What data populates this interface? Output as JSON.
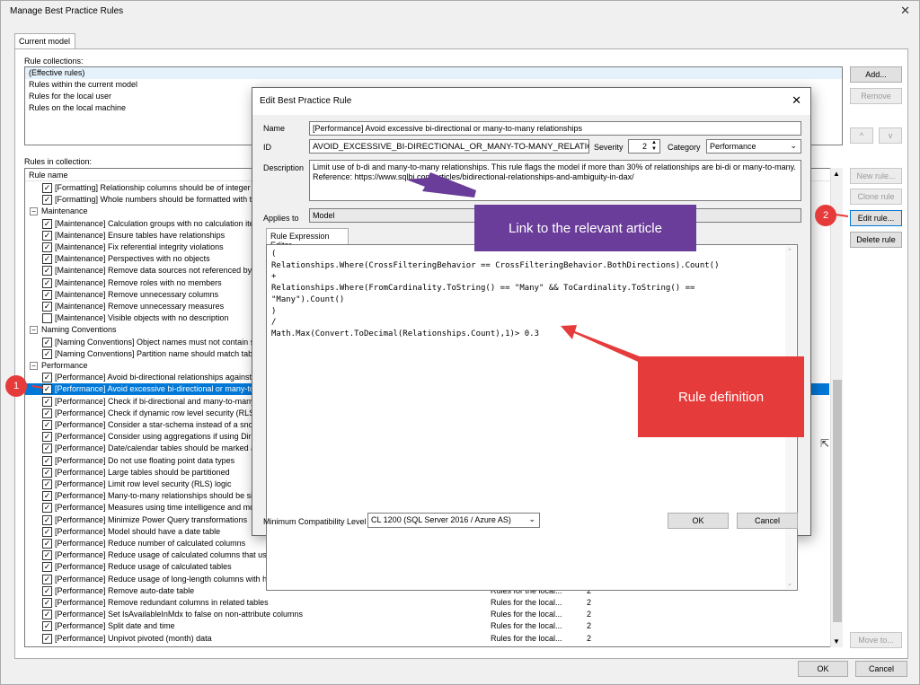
{
  "window": {
    "title": "Manage Best Practice Rules"
  },
  "tabs": [
    {
      "label": "Current model"
    }
  ],
  "collections": {
    "label": "Rule collections:",
    "items": [
      "(Effective rules)",
      "Rules within the current model",
      "Rules for the local user",
      "Rules on the local machine"
    ]
  },
  "collection_buttons": {
    "add": "Add...",
    "remove": "Remove",
    "up": "^",
    "down": "v"
  },
  "rules": {
    "label": "Rules in collection:",
    "header": "Rule name",
    "rows": [
      {
        "kind": "rule",
        "checked": true,
        "name": "[Formatting] Relationship columns should be of integer data type",
        "col2": "",
        "col3": ""
      },
      {
        "kind": "rule",
        "checked": true,
        "name": "[Formatting] Whole numbers should be formatted with thousands separators",
        "col2": "",
        "col3": ""
      },
      {
        "kind": "group",
        "name": "Maintenance"
      },
      {
        "kind": "rule",
        "checked": true,
        "name": "[Maintenance] Calculation groups with no calculation items",
        "col2": "",
        "col3": ""
      },
      {
        "kind": "rule",
        "checked": true,
        "name": "[Maintenance] Ensure tables have relationships",
        "col2": "",
        "col3": ""
      },
      {
        "kind": "rule",
        "checked": true,
        "name": "[Maintenance] Fix referential integrity violations",
        "col2": "",
        "col3": ""
      },
      {
        "kind": "rule",
        "checked": true,
        "name": "[Maintenance] Perspectives with no objects",
        "col2": "",
        "col3": ""
      },
      {
        "kind": "rule",
        "checked": true,
        "name": "[Maintenance] Remove data sources not referenced by any partitions",
        "col2": "",
        "col3": ""
      },
      {
        "kind": "rule",
        "checked": true,
        "name": "[Maintenance] Remove roles with no members",
        "col2": "",
        "col3": ""
      },
      {
        "kind": "rule",
        "checked": true,
        "name": "[Maintenance] Remove unnecessary columns",
        "col2": "",
        "col3": ""
      },
      {
        "kind": "rule",
        "checked": true,
        "name": "[Maintenance] Remove unnecessary measures",
        "col2": "",
        "col3": ""
      },
      {
        "kind": "rule",
        "checked": false,
        "name": "[Maintenance] Visible objects with no description",
        "col2": "",
        "col3": ""
      },
      {
        "kind": "group",
        "name": "Naming Conventions"
      },
      {
        "kind": "rule",
        "checked": true,
        "name": "[Naming Conventions] Object names must not contain special characters",
        "col2": "",
        "col3": ""
      },
      {
        "kind": "rule",
        "checked": true,
        "name": "[Naming Conventions] Partition name should match table name for single partition tables",
        "col2": "",
        "col3": ""
      },
      {
        "kind": "group",
        "name": "Performance"
      },
      {
        "kind": "rule",
        "checked": true,
        "name": "[Performance] Avoid bi-directional relationships against high-cardinality columns",
        "col2": "",
        "col3": ""
      },
      {
        "kind": "rule",
        "checked": true,
        "selected": true,
        "name": "[Performance] Avoid excessive bi-directional or many-to-many relationships",
        "col2": "",
        "col3": ""
      },
      {
        "kind": "rule",
        "checked": true,
        "name": "[Performance] Check if bi-directional and many-to-many relationships are valid",
        "col2": "",
        "col3": ""
      },
      {
        "kind": "rule",
        "checked": true,
        "name": "[Performance] Check if dynamic row level security (RLS) is necessary",
        "col2": "",
        "col3": ""
      },
      {
        "kind": "rule",
        "checked": true,
        "name": "[Performance] Consider a star-schema instead of a snowflake architecture",
        "col2": "",
        "col3": ""
      },
      {
        "kind": "rule",
        "checked": true,
        "name": "[Performance] Consider using aggregations if using DirectQuery",
        "col2": "",
        "col3": ""
      },
      {
        "kind": "rule",
        "checked": true,
        "name": "[Performance] Date/calendar tables should be marked as a date table",
        "col2": "",
        "col3": ""
      },
      {
        "kind": "rule",
        "checked": true,
        "name": "[Performance] Do not use floating point data types",
        "col2": "",
        "col3": ""
      },
      {
        "kind": "rule",
        "checked": true,
        "name": "[Performance] Large tables should be partitioned",
        "col2": "",
        "col3": ""
      },
      {
        "kind": "rule",
        "checked": true,
        "name": "[Performance] Limit row level security (RLS) logic",
        "col2": "",
        "col3": ""
      },
      {
        "kind": "rule",
        "checked": true,
        "name": "[Performance] Many-to-many relationships should be single-direction",
        "col2": "",
        "col3": ""
      },
      {
        "kind": "rule",
        "checked": true,
        "name": "[Performance] Measures using time intelligence and model is using DirectQuery",
        "col2": "",
        "col3": ""
      },
      {
        "kind": "rule",
        "checked": true,
        "name": "[Performance] Minimize Power Query transformations",
        "col2": "",
        "col3": ""
      },
      {
        "kind": "rule",
        "checked": true,
        "name": "[Performance] Model should have a date table",
        "col2": "",
        "col3": ""
      },
      {
        "kind": "rule",
        "checked": true,
        "name": "[Performance] Reduce number of calculated columns",
        "col2": "Rules for the local...",
        "col3": "2"
      },
      {
        "kind": "rule",
        "checked": true,
        "name": "[Performance] Reduce usage of calculated columns that use the RELATED function",
        "col2": "Rules for the local...",
        "col3": "2"
      },
      {
        "kind": "rule",
        "checked": true,
        "name": "[Performance] Reduce usage of calculated tables",
        "col2": "Rules for the local...",
        "col3": "2"
      },
      {
        "kind": "rule",
        "checked": true,
        "name": "[Performance] Reduce usage of long-length columns with high cardinality",
        "col2": "Rules for the local...",
        "col3": "2"
      },
      {
        "kind": "rule",
        "checked": true,
        "name": "[Performance] Remove auto-date table",
        "col2": "Rules for the local...",
        "col3": "2"
      },
      {
        "kind": "rule",
        "checked": true,
        "name": "[Performance] Remove redundant columns in related tables",
        "col2": "Rules for the local...",
        "col3": "2"
      },
      {
        "kind": "rule",
        "checked": true,
        "name": "[Performance] Set IsAvailableInMdx to false on non-attribute columns",
        "col2": "Rules for the local...",
        "col3": "2"
      },
      {
        "kind": "rule",
        "checked": true,
        "name": "[Performance] Split date and time",
        "col2": "Rules for the local...",
        "col3": "2"
      },
      {
        "kind": "rule",
        "checked": true,
        "name": "[Performance] Unpivot pivoted (month) data",
        "col2": "Rules for the local...",
        "col3": "2"
      }
    ]
  },
  "rule_buttons": {
    "new": "New rule...",
    "clone": "Clone rule",
    "edit": "Edit rule...",
    "delete": "Delete rule",
    "move": "Move to..."
  },
  "footer": {
    "ok": "OK",
    "cancel": "Cancel"
  },
  "dialog": {
    "title": "Edit Best Practice Rule",
    "name_label": "Name",
    "name_value": "[Performance] Avoid excessive bi-directional or many-to-many relationships",
    "id_label": "ID",
    "id_value": "AVOID_EXCESSIVE_BI-DIRECTIONAL_OR_MANY-TO-MANY_RELATIONSI",
    "severity_label": "Severity",
    "severity_value": "2",
    "category_label": "Category",
    "category_value": "Performance",
    "description_label": "Description",
    "description_line1": "Limit use of b-di and many-to-many relationships. This rule flags the model if more than 30% of relationships are bi-di or many-to-many.",
    "description_line2": "Reference: https://www.sqlbi.com/articles/bidirectional-relationships-and-ambiguity-in-dax/",
    "applies_label": "Applies to",
    "applies_value": "Model",
    "editor_tab": "Rule Expression Editor",
    "code": "(\nRelationships.Where(CrossFilteringBehavior == CrossFilteringBehavior.BothDirections).Count()\n+\nRelationships.Where(FromCardinality.ToString() == \"Many\" && ToCardinality.ToString() ==\n\"Many\").Count()\n)\n/\nMath.Max(Convert.ToDecimal(Relationships.Count),1)> 0.3",
    "compat_label": "Minimum Compatibility Level",
    "compat_value": "CL 1200 (SQL Server 2016 / Azure AS)",
    "ok": "OK",
    "cancel": "Cancel"
  },
  "annotations": {
    "link_callout": "Link to the relevant article",
    "rule_callout": "Rule definition",
    "badge1": "1",
    "badge2": "2",
    "purple": "#6a3d9a",
    "red": "#e63b3b"
  }
}
